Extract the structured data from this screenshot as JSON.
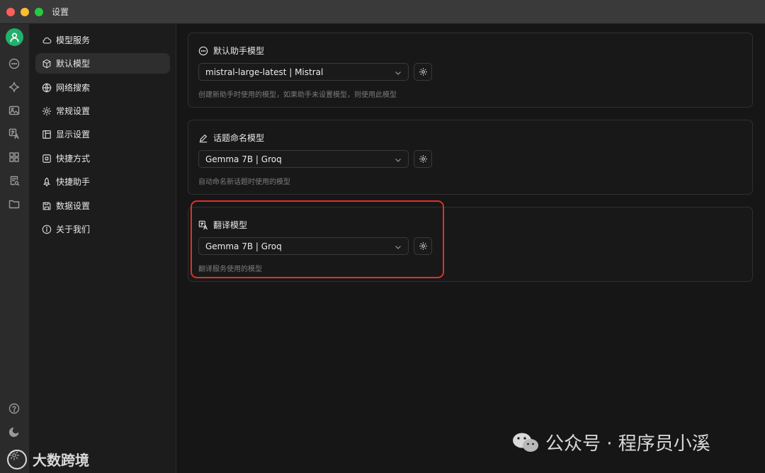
{
  "window": {
    "title": "设置"
  },
  "sidebar": {
    "items": [
      {
        "label": "模型服务",
        "icon": "cloud-icon"
      },
      {
        "label": "默认模型",
        "icon": "cube-icon",
        "active": true
      },
      {
        "label": "网络搜索",
        "icon": "globe-icon"
      },
      {
        "label": "常规设置",
        "icon": "gear-icon"
      },
      {
        "label": "显示设置",
        "icon": "layout-icon"
      },
      {
        "label": "快捷方式",
        "icon": "command-icon"
      },
      {
        "label": "快捷助手",
        "icon": "rocket-icon"
      },
      {
        "label": "数据设置",
        "icon": "save-icon"
      },
      {
        "label": "关于我们",
        "icon": "info-icon"
      }
    ]
  },
  "sections": [
    {
      "title": "默认助手模型",
      "icon": "chat-icon",
      "selected": "mistral-large-latest | Mistral",
      "hint": "创建新助手时使用的模型，如果助手未设置模型，则使用此模型"
    },
    {
      "title": "话题命名模型",
      "icon": "pencil-icon",
      "selected": "Gemma 7B | Groq",
      "hint": "自动命名新话题时使用的模型"
    },
    {
      "title": "翻译模型",
      "icon": "translate-icon",
      "selected": "Gemma 7B | Groq",
      "hint": "翻译服务使用的模型"
    }
  ],
  "watermark": {
    "text": "公众号 · 程序员小溪",
    "bottom_left": "大数跨境"
  },
  "colors": {
    "accent_green": "#20b26b",
    "highlight_red": "#e0302a"
  }
}
